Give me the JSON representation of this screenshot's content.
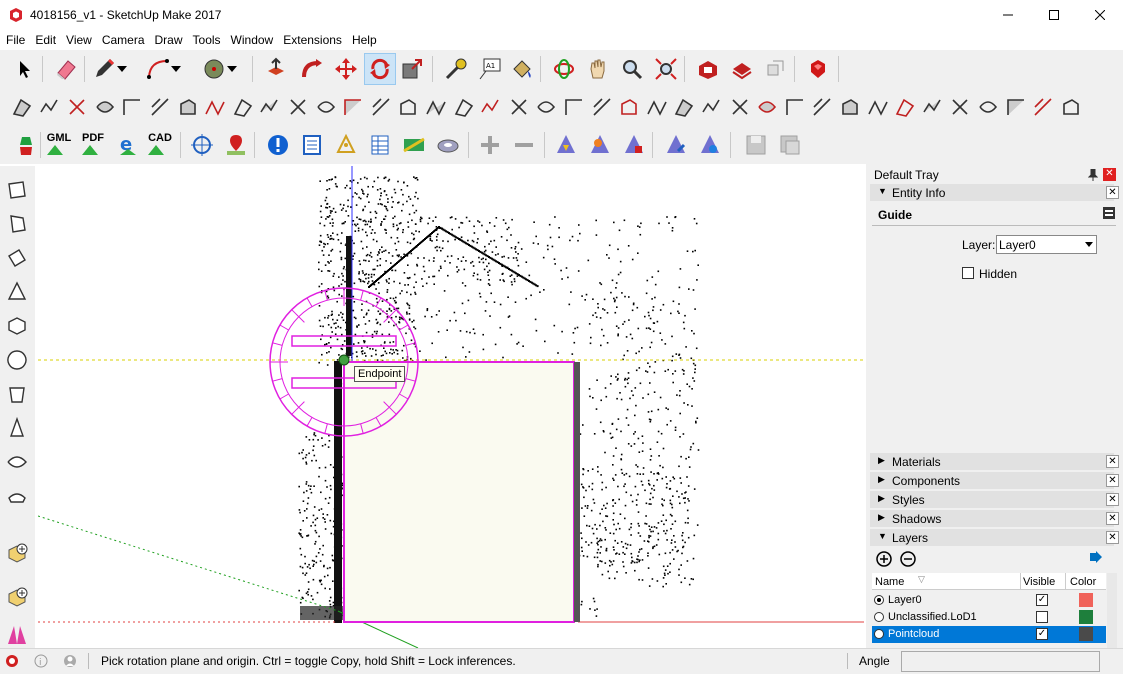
{
  "window": {
    "title": "4018156_v1 - SketchUp Make 2017",
    "minimize_icon": "minimize-icon",
    "maximize_icon": "maximize-icon",
    "close_icon": "close-icon"
  },
  "menu": [
    "File",
    "Edit",
    "View",
    "Camera",
    "Draw",
    "Tools",
    "Window",
    "Extensions",
    "Help"
  ],
  "toolbar3_labels": {
    "gml": "GML",
    "pdf": "PDF",
    "cad": "CAD"
  },
  "viewport": {
    "tooltip": "Endpoint"
  },
  "tray": {
    "title": "Default Tray",
    "entity_info": {
      "header": "Entity Info",
      "entity_type": "Guide",
      "layer_label": "Layer:",
      "layer_value": "Layer0",
      "hidden_label": "Hidden"
    },
    "panels": [
      "Materials",
      "Components",
      "Styles",
      "Shadows"
    ],
    "layers": {
      "header": "Layers",
      "col_name": "Name",
      "col_visible": "Visible",
      "col_color": "Color",
      "rows": [
        {
          "name": "Layer0",
          "visible": true,
          "color": "#f0625a",
          "active": true,
          "selected": false
        },
        {
          "name": "Unclassified.LoD1",
          "visible": false,
          "color": "#1e7f3c",
          "active": false,
          "selected": false
        },
        {
          "name": "Pointcloud",
          "visible": true,
          "color": "#4a4a4a",
          "active": false,
          "selected": true
        }
      ]
    }
  },
  "status": {
    "message": "Pick rotation plane and origin.  Ctrl = toggle Copy, hold Shift = Lock inferences.",
    "measure_label": "Angle",
    "measure_value": ""
  },
  "colors": {
    "accent_selection": "#0078d7",
    "protractor": "#e020e0",
    "face": "#fafaf0",
    "axis_blue": "#3030ff",
    "axis_red": "#e04040",
    "axis_green": "#20a020"
  }
}
